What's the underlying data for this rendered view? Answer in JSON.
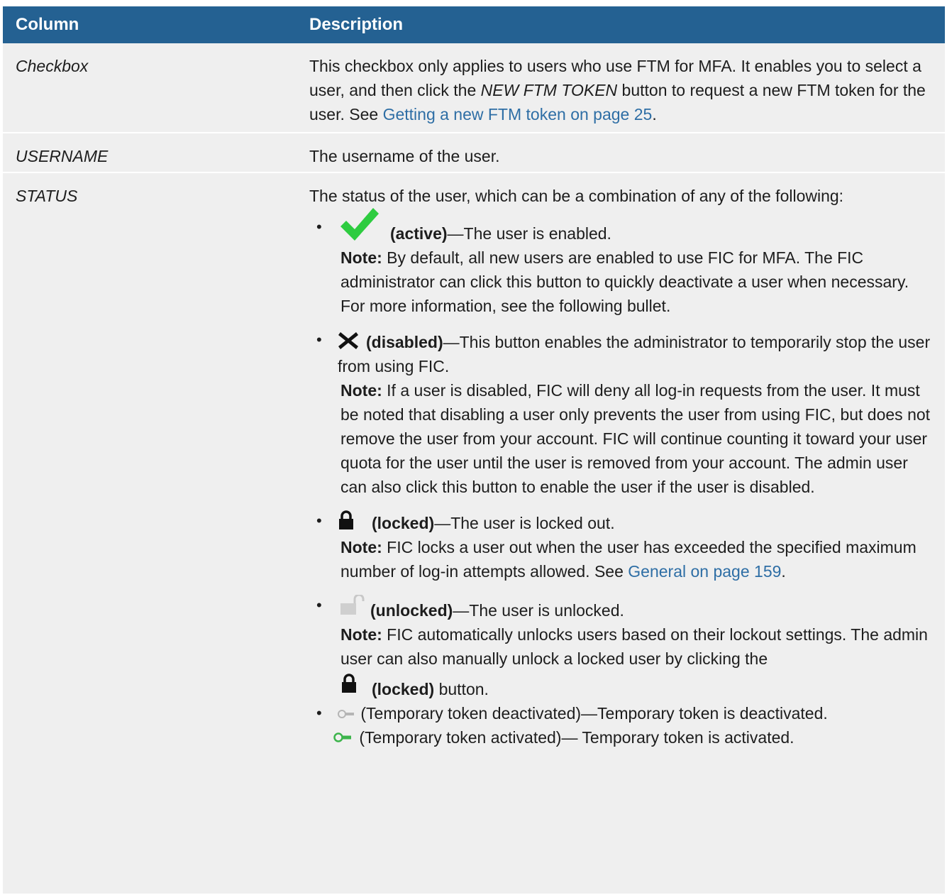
{
  "table": {
    "headers": [
      "Column",
      "Description"
    ],
    "rows": [
      {
        "column": "Checkbox",
        "desc_part1": "This checkbox only applies to users who use FTM for MFA. It enables you to select a user, and then click the ",
        "desc_em": "NEW FTM TOKEN",
        "desc_part2": " button to request a new FTM token for the user. See ",
        "desc_link": "Getting a new FTM token on page 25",
        "desc_end": "."
      },
      {
        "column": "USERNAME",
        "desc": "The username of the user."
      },
      {
        "column": "STATUS",
        "desc_intro": "The status of the user, which can be a combination of any of the following:",
        "items": [
          {
            "icon": "checkmark-icon",
            "label": "(active)",
            "text": "—The user is enabled.",
            "note_label": "Note:",
            "note": " By default, all new users are enabled to use FIC for MFA. The FIC administrator can click this button to quickly deactivate a user when necessary. For more information, see the following bullet."
          },
          {
            "icon": "x-icon",
            "label": "(disabled)",
            "text": "—This button enables the administrator to temporarily stop the user from using FIC.",
            "note_label": "Note:",
            "note": " If a user is disabled, FIC will deny all log-in requests from the user. It must be noted that disabling a user only prevents the user from using FIC, but does not remove the user from your account. FIC will continue counting it toward your user quota for the user until the user is removed from your account. The admin user can also click this button to enable the user if the user is disabled."
          },
          {
            "icon": "lock-icon",
            "label": "(locked)",
            "text": "—The user is locked out.",
            "note_label": "Note:",
            "note": " FIC locks a user out when the user has exceeded the specified maximum number of log-in attempts allowed. See ",
            "note_link": "General on page 159",
            "note_end": "."
          },
          {
            "icon": "unlock-icon",
            "label": "(unlocked)",
            "text": "—The user is unlocked.",
            "note_label": "Note:",
            "note": " FIC automatically unlocks users based on their lockout settings. The admin user can also manually unlock a locked user by clicking the",
            "tail_label": "(locked)",
            "tail_text": " button."
          },
          {
            "icon": "temp-token-inactive-icon",
            "text": " (Temporary token deactivated)—Temporary token is deactivated.",
            "icon2": "temp-token-active-icon",
            "text2": " (Temporary token activated)— Temporary token is activated."
          }
        ]
      }
    ]
  },
  "colors": {
    "header_bg": "#246192",
    "row_bg": "#efefef",
    "link": "#2e6ea5",
    "check": "#2ecc40",
    "token_active": "#3cb44b",
    "token_inactive": "#b5b5b5"
  }
}
